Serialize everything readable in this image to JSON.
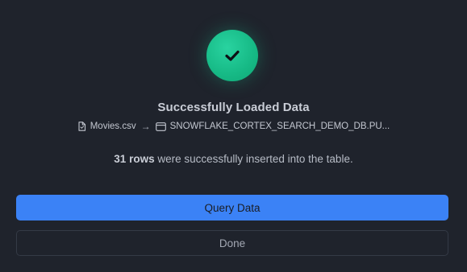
{
  "dialog": {
    "icon": "checkmark-icon",
    "title": "Successfully Loaded Data",
    "source": {
      "icon": "file-icon",
      "name": "Movies.csv"
    },
    "arrow": "→",
    "destination": {
      "icon": "database-table-icon",
      "name": "SNOWFLAKE_CORTEX_SEARCH_DEMO_DB.PU..."
    },
    "message": {
      "count": "31 rows",
      "text": " were successfully inserted into the table."
    },
    "primary_button": "Query Data",
    "secondary_button": "Done"
  },
  "colors": {
    "background": "#1f232c",
    "success": "#16b985",
    "primary": "#3b82f6"
  }
}
